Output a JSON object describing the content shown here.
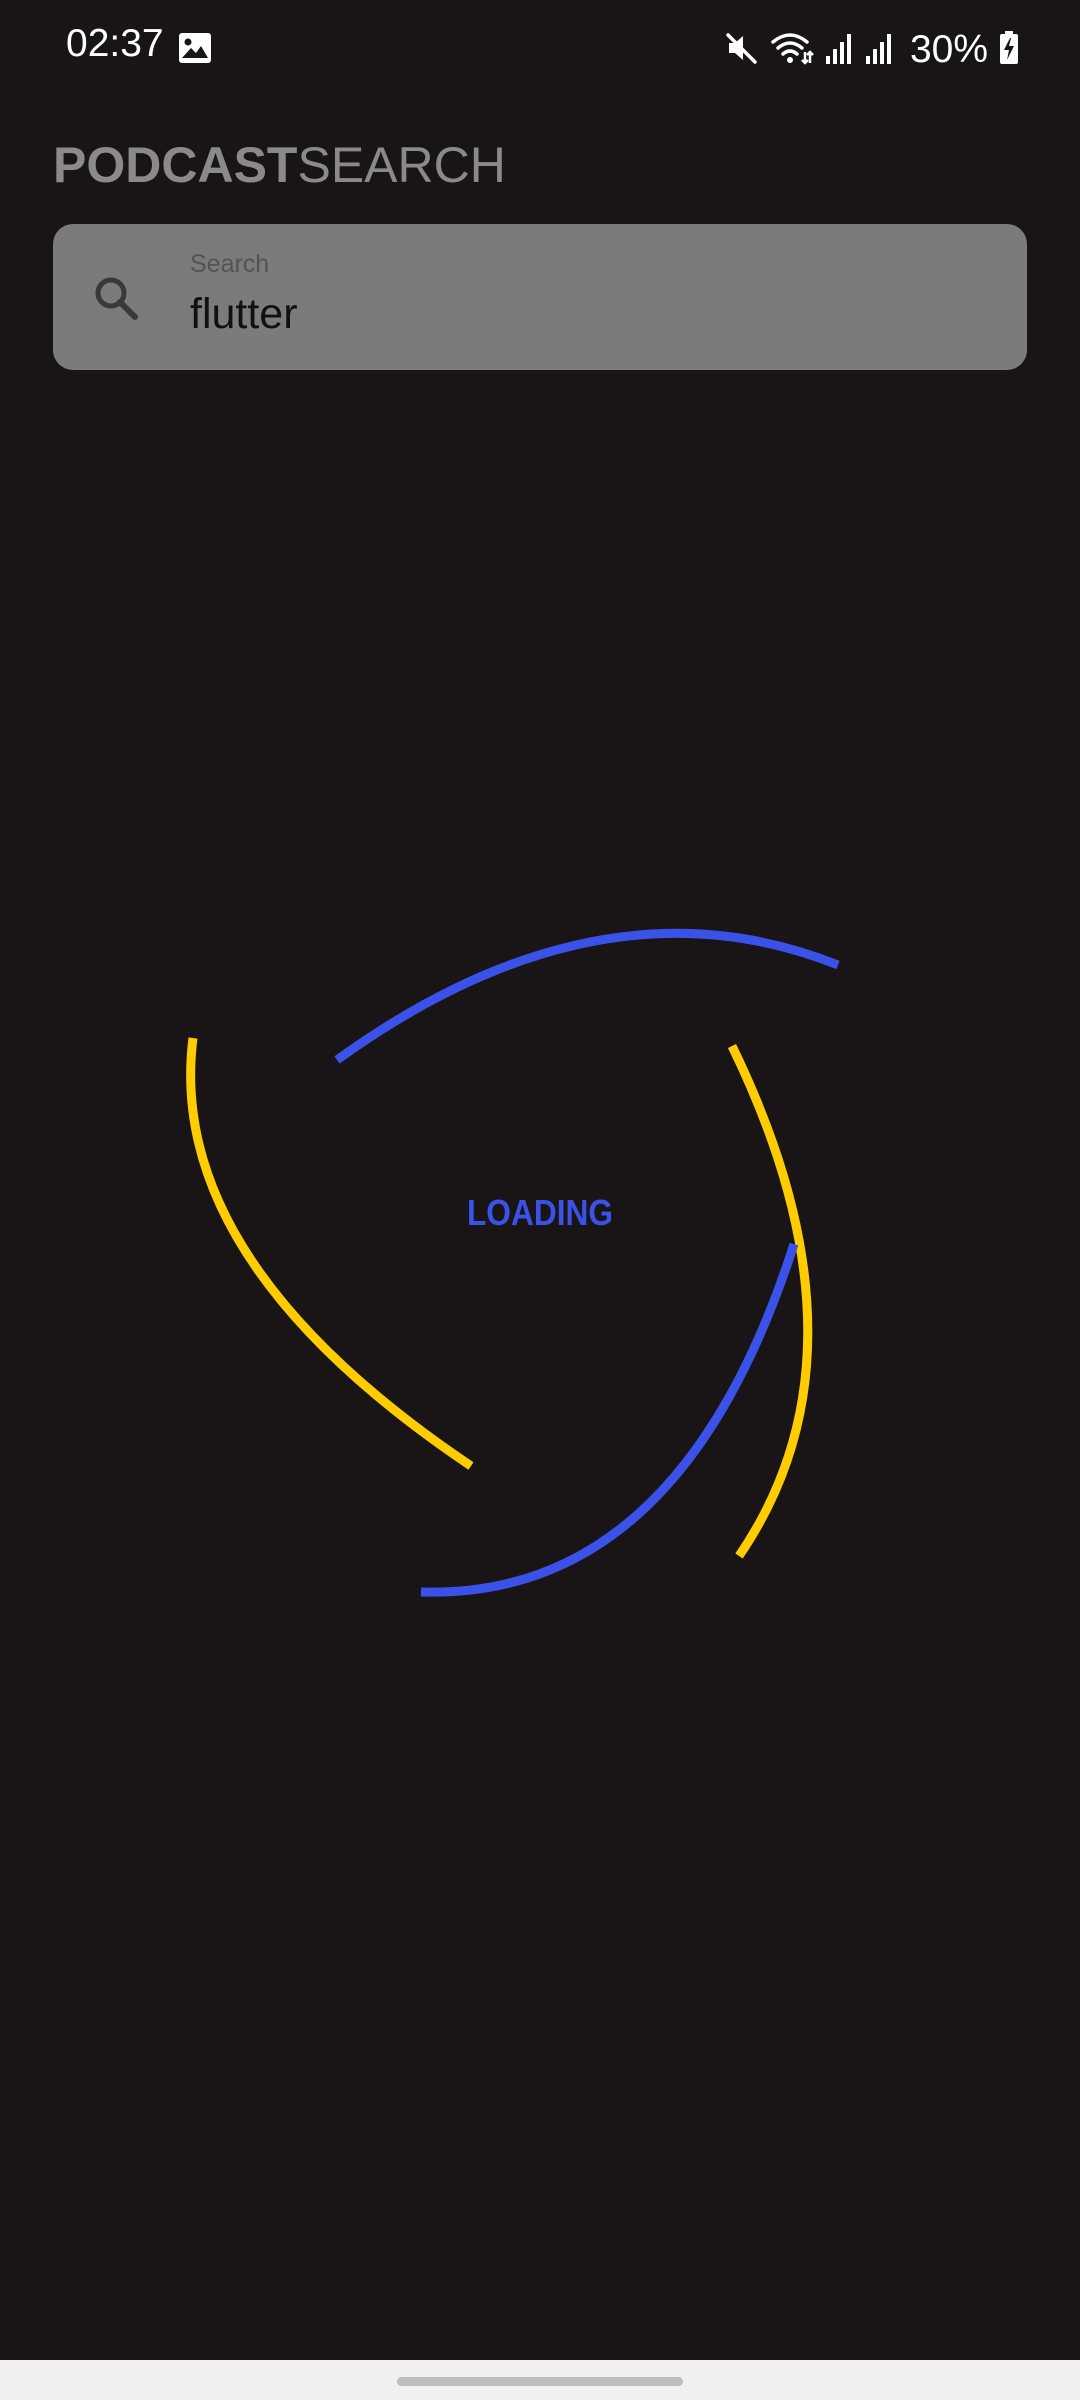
{
  "status_bar": {
    "time": "02:37",
    "battery": "30%",
    "icons": [
      "gallery-icon",
      "mute-icon",
      "wifi-icon",
      "signal-icon",
      "signal-icon",
      "battery-charging-icon"
    ]
  },
  "app_title": {
    "bold_part": "PODCAST",
    "light_part": "SEARCH"
  },
  "search": {
    "label": "Search",
    "value": "flutter",
    "icon": "search-icon"
  },
  "loader": {
    "text": "LOADING",
    "colors": {
      "blue": "#3a52e8",
      "yellow": "#ffcc00"
    }
  },
  "colors": {
    "background": "#191516",
    "search_box": "#7d7b7a",
    "title": "#8a8a8a"
  }
}
